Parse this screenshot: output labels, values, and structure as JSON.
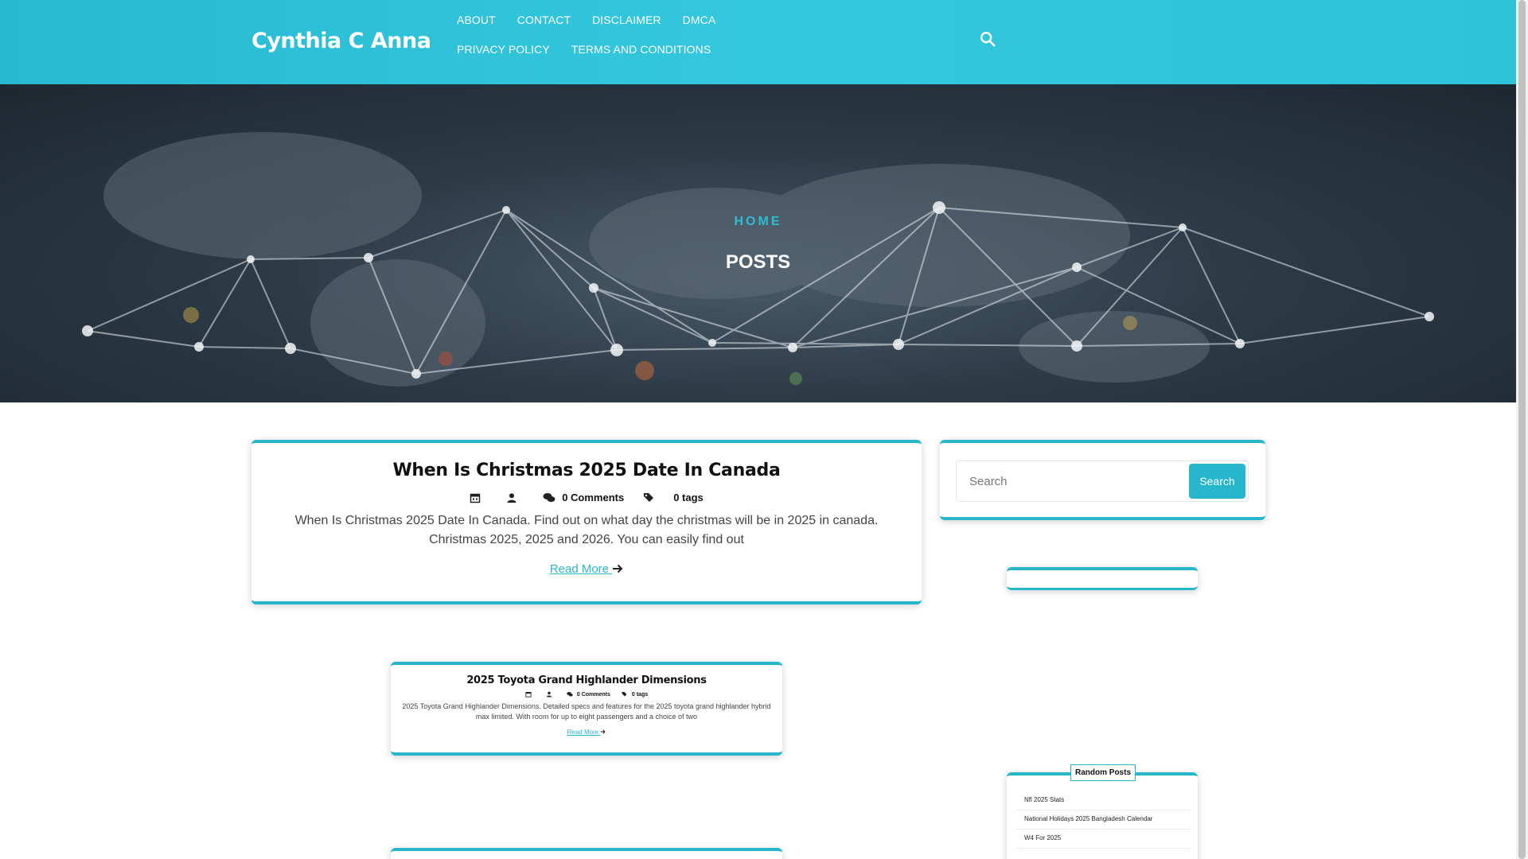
{
  "site": {
    "title": "Cynthia C Anna"
  },
  "nav": {
    "items": [
      "ABOUT",
      "CONTACT",
      "DISCLAIMER",
      "DMCA",
      "PRIVACY POLICY",
      "TERMS AND CONDITIONS"
    ]
  },
  "hero": {
    "breadcrumb": "HOME",
    "page_title": "POSTS"
  },
  "posts": [
    {
      "title": "When Is Christmas 2025 Date In Canada",
      "comments": "0 Comments",
      "tags": "0 tags",
      "excerpt": "When Is Christmas 2025 Date In Canada. Find out on what day the christmas will be in 2025 in canada. Christmas 2025, 2025 and 2026. You can easily find out",
      "read_more": "Read More"
    },
    {
      "title": "2025 Toyota Grand Highlander Dimensions",
      "comments": "0 Comments",
      "tags": "0 tags",
      "excerpt": "2025 Toyota Grand Highlander Dimensions. Detailed specs and features for the 2025 toyota grand highlander hybrid max limited. With room for up to eight passengers and a choice of two",
      "read_more": "Read More"
    }
  ],
  "sidebar": {
    "search": {
      "placeholder": "Search",
      "button": "Search"
    },
    "random_posts": {
      "title": "Random Posts",
      "items": [
        "Nfl 2025 Stats",
        "National Holidays 2025 Bangladesh Calendar",
        "W4 For 2025"
      ]
    }
  },
  "colors": {
    "accent": "#27b6cc",
    "header": "#2fc3d9"
  },
  "icons": [
    "search-icon",
    "calendar-icon",
    "user-icon",
    "comments-icon",
    "tags-icon",
    "arrow-right-icon"
  ]
}
